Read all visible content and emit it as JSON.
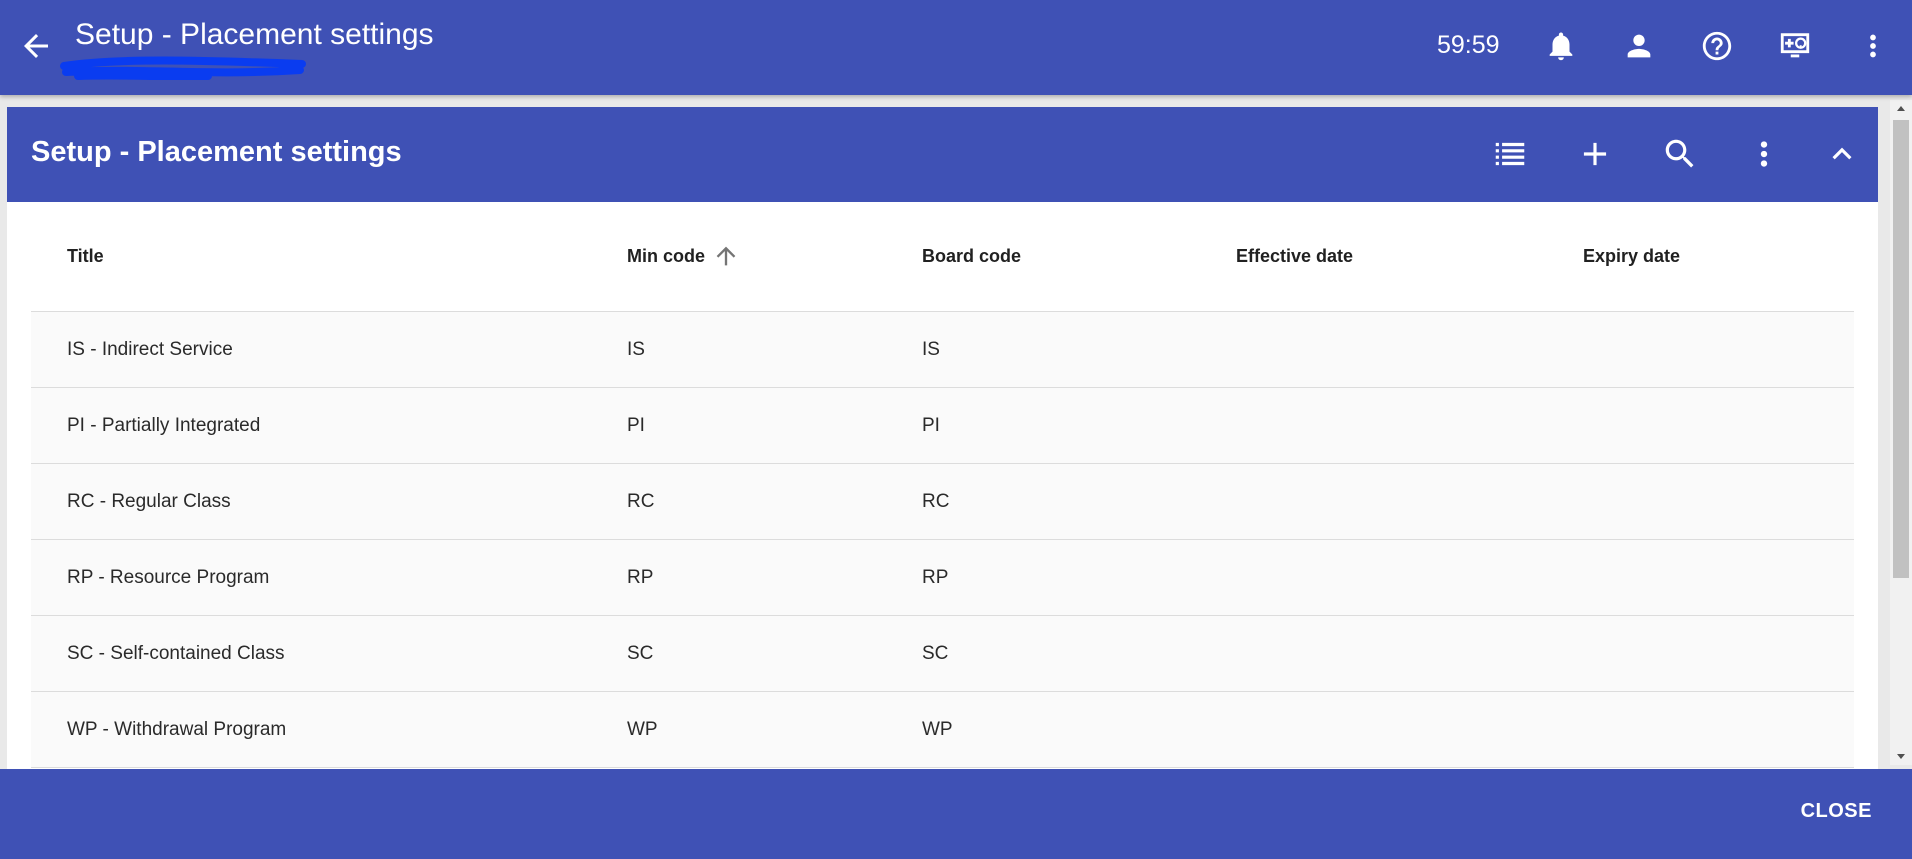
{
  "appbar": {
    "title": "Setup - Placement settings",
    "timer": "59:59",
    "icons": [
      "back-arrow-icon",
      "bell-icon",
      "person-icon",
      "help-circle-icon",
      "remote-help-icon",
      "more-vertical-icon"
    ]
  },
  "panel": {
    "title": "Setup - Placement settings",
    "icons": [
      "list-view-icon",
      "add-icon",
      "search-icon",
      "more-vertical-icon",
      "chevron-up-icon"
    ]
  },
  "table": {
    "columns": {
      "title": "Title",
      "min_code": "Min code",
      "board_code": "Board code",
      "effective_date": "Effective date",
      "expiry_date": "Expiry date"
    },
    "sort": {
      "column": "Min code",
      "direction": "ascending"
    },
    "rows": [
      {
        "title": "IS - Indirect Service",
        "min_code": "IS",
        "board_code": "IS",
        "effective_date": "",
        "expiry_date": ""
      },
      {
        "title": "PI - Partially Integrated",
        "min_code": "PI",
        "board_code": "PI",
        "effective_date": "",
        "expiry_date": ""
      },
      {
        "title": "RC - Regular Class",
        "min_code": "RC",
        "board_code": "RC",
        "effective_date": "",
        "expiry_date": ""
      },
      {
        "title": "RP - Resource Program",
        "min_code": "RP",
        "board_code": "RP",
        "effective_date": "",
        "expiry_date": ""
      },
      {
        "title": "SC - Self-contained Class",
        "min_code": "SC",
        "board_code": "SC",
        "effective_date": "",
        "expiry_date": ""
      },
      {
        "title": "WP - Withdrawal Program",
        "min_code": "WP",
        "board_code": "WP",
        "effective_date": "",
        "expiry_date": ""
      }
    ]
  },
  "footer": {
    "close_label": "CLOSE"
  },
  "colors": {
    "primary": "#3f51b5",
    "scribble": "#0a3cf0",
    "row_bg": "#fafafa"
  }
}
